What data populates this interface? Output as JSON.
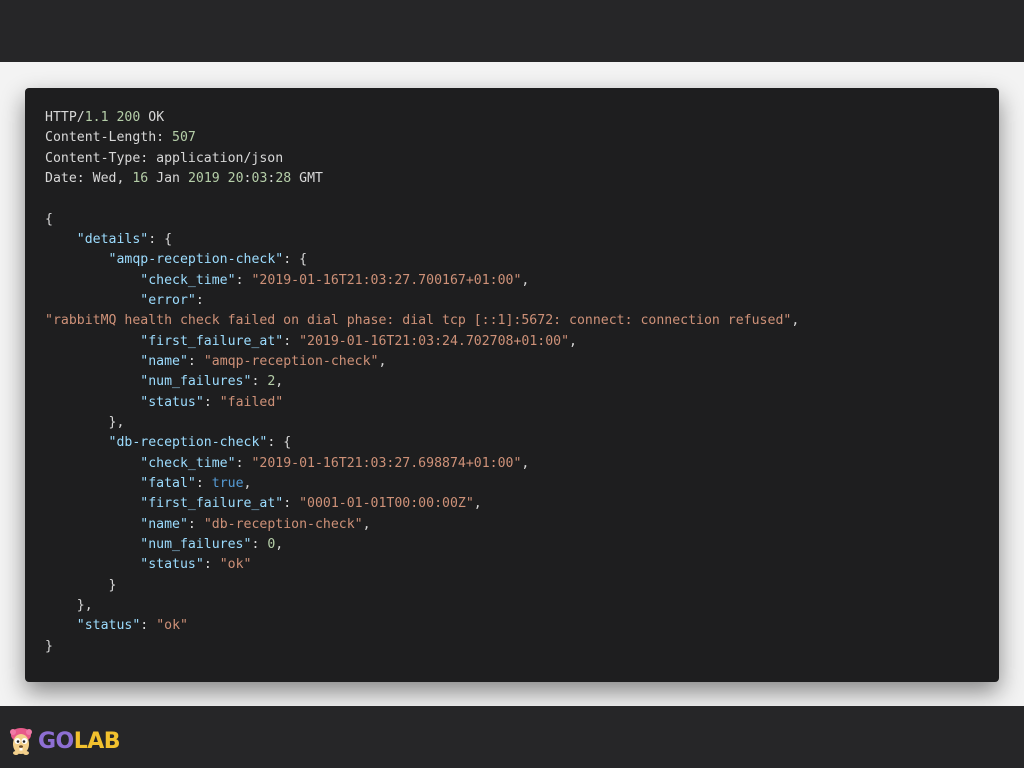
{
  "colors": {
    "background": "#262628",
    "slide": "#f3f3f3",
    "code_panel": "#1e1e1f",
    "key": "#9cdcfe",
    "string": "#ce9178",
    "number": "#b5cea8",
    "boolean": "#569cd6",
    "plain": "#d8d8d8",
    "logo_go": "#8e6fd4",
    "logo_lab": "#f2c12e"
  },
  "code_lines": [
    [
      [
        "HTTP/",
        "plain"
      ],
      [
        "1.1",
        "num"
      ],
      [
        " ",
        "plain"
      ],
      [
        "200",
        "num"
      ],
      [
        " OK",
        "plain"
      ]
    ],
    [
      [
        "Content-Length: ",
        "plain"
      ],
      [
        "507",
        "num"
      ]
    ],
    [
      [
        "Content-Type: application/json",
        "plain"
      ]
    ],
    [
      [
        "Date: Wed, ",
        "plain"
      ],
      [
        "16",
        "num"
      ],
      [
        " Jan ",
        "plain"
      ],
      [
        "2019",
        "num"
      ],
      [
        " ",
        "plain"
      ],
      [
        "20",
        "num"
      ],
      [
        ":",
        "plain"
      ],
      [
        "03",
        "num"
      ],
      [
        ":",
        "plain"
      ],
      [
        "28",
        "num"
      ],
      [
        " GMT",
        "plain"
      ]
    ],
    [],
    [
      [
        "{",
        "plain"
      ]
    ],
    [
      [
        "    ",
        "plain"
      ],
      [
        "\"details\"",
        "key"
      ],
      [
        ": {",
        "plain"
      ]
    ],
    [
      [
        "        ",
        "plain"
      ],
      [
        "\"amqp-reception-check\"",
        "key"
      ],
      [
        ": {",
        "plain"
      ]
    ],
    [
      [
        "            ",
        "plain"
      ],
      [
        "\"check_time\"",
        "key"
      ],
      [
        ": ",
        "plain"
      ],
      [
        "\"2019-01-16T21:03:27.700167+01:00\"",
        "str"
      ],
      [
        ",",
        "plain"
      ]
    ],
    [
      [
        "            ",
        "plain"
      ],
      [
        "\"error\"",
        "key"
      ],
      [
        ":",
        "plain"
      ]
    ],
    [
      [
        "\"rabbitMQ health check failed on dial phase: dial tcp [::1]:5672: connect: connection refused\"",
        "str"
      ],
      [
        ",",
        "plain"
      ]
    ],
    [
      [
        "            ",
        "plain"
      ],
      [
        "\"first_failure_at\"",
        "key"
      ],
      [
        ": ",
        "plain"
      ],
      [
        "\"2019-01-16T21:03:24.702708+01:00\"",
        "str"
      ],
      [
        ",",
        "plain"
      ]
    ],
    [
      [
        "            ",
        "plain"
      ],
      [
        "\"name\"",
        "key"
      ],
      [
        ": ",
        "plain"
      ],
      [
        "\"amqp-reception-check\"",
        "str"
      ],
      [
        ",",
        "plain"
      ]
    ],
    [
      [
        "            ",
        "plain"
      ],
      [
        "\"num_failures\"",
        "key"
      ],
      [
        ": ",
        "plain"
      ],
      [
        "2",
        "num"
      ],
      [
        ",",
        "plain"
      ]
    ],
    [
      [
        "            ",
        "plain"
      ],
      [
        "\"status\"",
        "key"
      ],
      [
        ": ",
        "plain"
      ],
      [
        "\"failed\"",
        "str"
      ]
    ],
    [
      [
        "        },",
        "plain"
      ]
    ],
    [
      [
        "        ",
        "plain"
      ],
      [
        "\"db-reception-check\"",
        "key"
      ],
      [
        ": {",
        "plain"
      ]
    ],
    [
      [
        "            ",
        "plain"
      ],
      [
        "\"check_time\"",
        "key"
      ],
      [
        ": ",
        "plain"
      ],
      [
        "\"2019-01-16T21:03:27.698874+01:00\"",
        "str"
      ],
      [
        ",",
        "plain"
      ]
    ],
    [
      [
        "            ",
        "plain"
      ],
      [
        "\"fatal\"",
        "key"
      ],
      [
        ": ",
        "plain"
      ],
      [
        "true",
        "bool"
      ],
      [
        ",",
        "plain"
      ]
    ],
    [
      [
        "            ",
        "plain"
      ],
      [
        "\"first_failure_at\"",
        "key"
      ],
      [
        ": ",
        "plain"
      ],
      [
        "\"0001-01-01T00:00:00Z\"",
        "str"
      ],
      [
        ",",
        "plain"
      ]
    ],
    [
      [
        "            ",
        "plain"
      ],
      [
        "\"name\"",
        "key"
      ],
      [
        ": ",
        "plain"
      ],
      [
        "\"db-reception-check\"",
        "str"
      ],
      [
        ",",
        "plain"
      ]
    ],
    [
      [
        "            ",
        "plain"
      ],
      [
        "\"num_failures\"",
        "key"
      ],
      [
        ": ",
        "plain"
      ],
      [
        "0",
        "num"
      ],
      [
        ",",
        "plain"
      ]
    ],
    [
      [
        "            ",
        "plain"
      ],
      [
        "\"status\"",
        "key"
      ],
      [
        ": ",
        "plain"
      ],
      [
        "\"ok\"",
        "str"
      ]
    ],
    [
      [
        "        }",
        "plain"
      ]
    ],
    [
      [
        "    },",
        "plain"
      ]
    ],
    [
      [
        "    ",
        "plain"
      ],
      [
        "\"status\"",
        "key"
      ],
      [
        ": ",
        "plain"
      ],
      [
        "\"ok\"",
        "str"
      ]
    ],
    [
      [
        "}",
        "plain"
      ]
    ]
  ],
  "logo": {
    "go": "GO",
    "lab": "LAB",
    "icon": "gopher-mascot-icon"
  }
}
